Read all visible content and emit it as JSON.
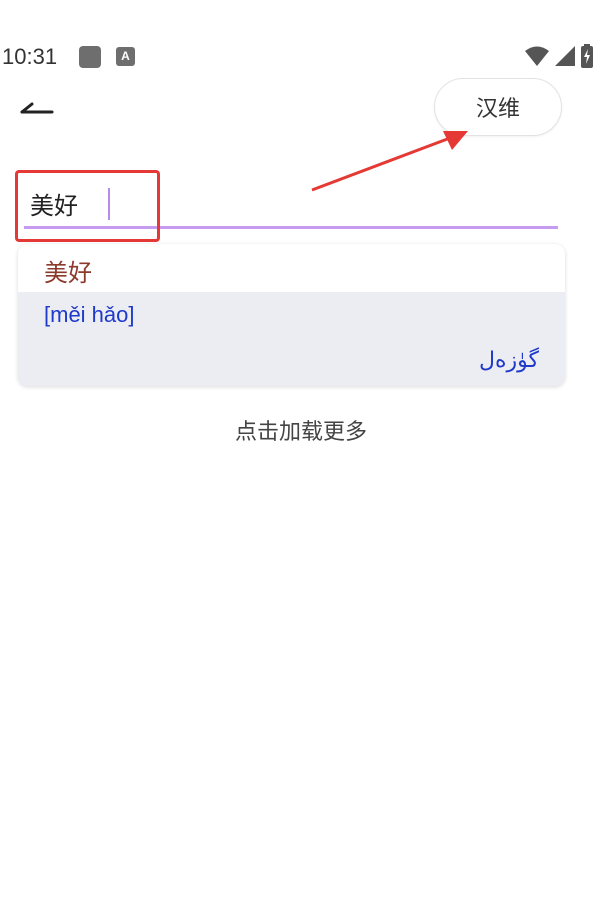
{
  "status_bar": {
    "time": "10:31",
    "notification_icons": [
      "app-notification-icon",
      "a-notification-icon"
    ],
    "notification_a_glyph": "A",
    "right_icons": [
      "wifi-icon",
      "cellular-signal-icon",
      "battery-charging-icon"
    ]
  },
  "header": {
    "back_icon": "back-arrow-icon",
    "language_toggle": "汉维"
  },
  "search": {
    "value": "美好"
  },
  "results": [
    {
      "word": "美好",
      "pinyin": "[měi hǎo]",
      "translation": "گۈزەل"
    }
  ],
  "load_more": "点击加载更多",
  "colors": {
    "accent_underline": "#c79bf2",
    "highlight_red": "#e53935",
    "word_color": "#8b3a2b",
    "pinyin_color": "#1f39c8",
    "card_background": "#ebedf3"
  }
}
